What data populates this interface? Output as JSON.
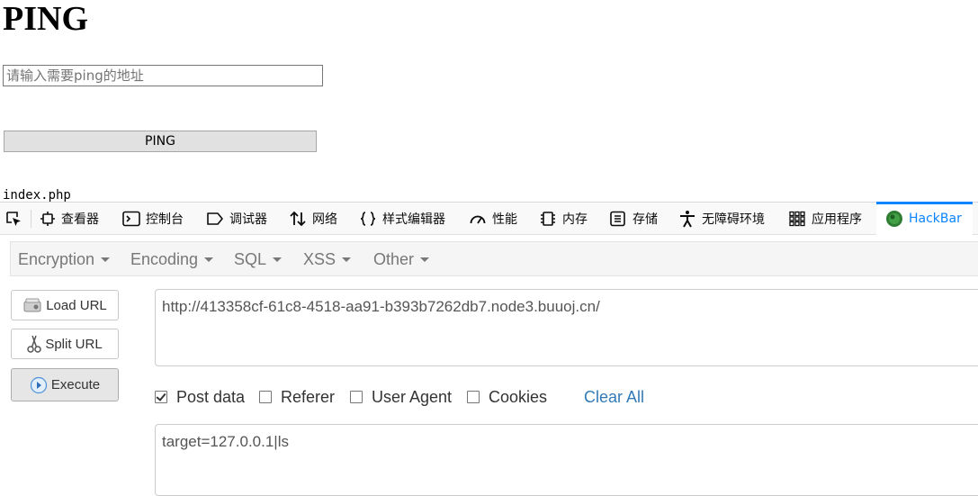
{
  "page": {
    "title": "PING",
    "input_placeholder": "请输入需要ping的地址",
    "input_value": "",
    "button_label": "PING",
    "result": "index.php"
  },
  "devtools": {
    "tabs": [
      {
        "label": "查看器",
        "icon": "inspector-icon"
      },
      {
        "label": "控制台",
        "icon": "console-icon"
      },
      {
        "label": "调试器",
        "icon": "debugger-icon"
      },
      {
        "label": "网络",
        "icon": "network-icon"
      },
      {
        "label": "样式编辑器",
        "icon": "style-editor-icon"
      },
      {
        "label": "性能",
        "icon": "performance-icon"
      },
      {
        "label": "内存",
        "icon": "memory-icon"
      },
      {
        "label": "存储",
        "icon": "storage-icon"
      },
      {
        "label": "无障碍环境",
        "icon": "accessibility-icon"
      },
      {
        "label": "应用程序",
        "icon": "application-icon"
      },
      {
        "label": "HackBar",
        "icon": "hackbar-icon",
        "active": true
      }
    ],
    "accent_color": "#0a84ff"
  },
  "hackbar": {
    "menus": [
      "Encryption",
      "Encoding",
      "SQL",
      "XSS",
      "Other"
    ],
    "buttons": {
      "load_url": "Load URL",
      "split_url": "Split URL",
      "execute": "Execute"
    },
    "url": "http://413358cf-61c8-4518-aa91-b393b7262db7.node3.buuoj.cn/",
    "options": {
      "post_data": {
        "label": "Post data",
        "checked": true
      },
      "referer": {
        "label": "Referer",
        "checked": false
      },
      "user_agent": {
        "label": "User Agent",
        "checked": false
      },
      "cookies": {
        "label": "Cookies",
        "checked": false
      }
    },
    "clear_all": "Clear All",
    "post_body": "target=127.0.0.1|ls",
    "link_color": "#337ab7"
  }
}
